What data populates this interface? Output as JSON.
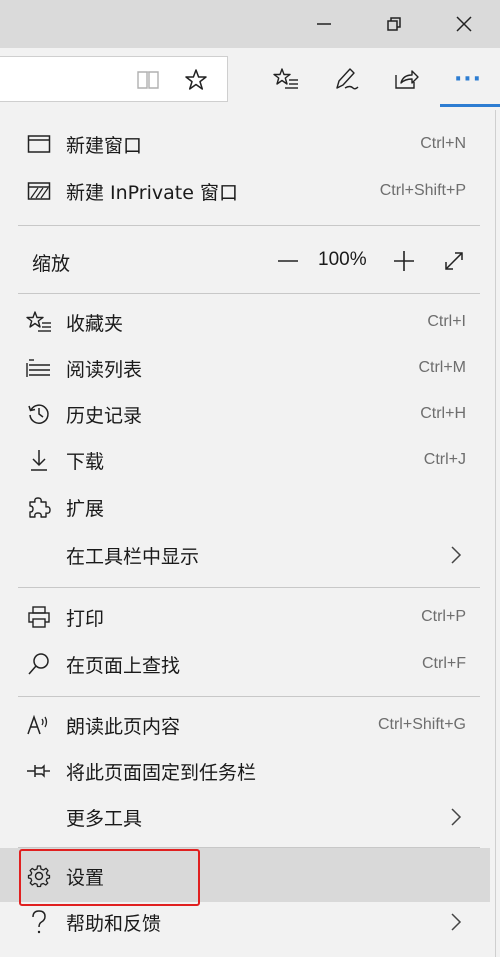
{
  "menu": {
    "new_window": {
      "label": "新建窗口",
      "shortcut": "Ctrl+N"
    },
    "new_inprivate": {
      "label": "新建 InPrivate 窗口",
      "shortcut": "Ctrl+Shift+P"
    },
    "zoom": {
      "label": "缩放",
      "value": "100%"
    },
    "favorites": {
      "label": "收藏夹",
      "shortcut": "Ctrl+I"
    },
    "reading_list": {
      "label": "阅读列表",
      "shortcut": "Ctrl+M"
    },
    "history": {
      "label": "历史记录",
      "shortcut": "Ctrl+H"
    },
    "downloads": {
      "label": "下载",
      "shortcut": "Ctrl+J"
    },
    "extensions": {
      "label": "扩展"
    },
    "show_in_toolbar": {
      "label": "在工具栏中显示"
    },
    "print": {
      "label": "打印",
      "shortcut": "Ctrl+P"
    },
    "find_on_page": {
      "label": "在页面上查找",
      "shortcut": "Ctrl+F"
    },
    "read_aloud": {
      "label": "朗读此页内容",
      "shortcut": "Ctrl+Shift+G"
    },
    "pin_to_taskbar": {
      "label": "将此页面固定到任务栏"
    },
    "more_tools": {
      "label": "更多工具"
    },
    "settings": {
      "label": "设置"
    },
    "help_feedback": {
      "label": "帮助和反馈"
    }
  },
  "toolbar": {
    "more_label": "···"
  },
  "colors": {
    "accent": "#2d7dd2",
    "highlight_box": "#e02020"
  }
}
